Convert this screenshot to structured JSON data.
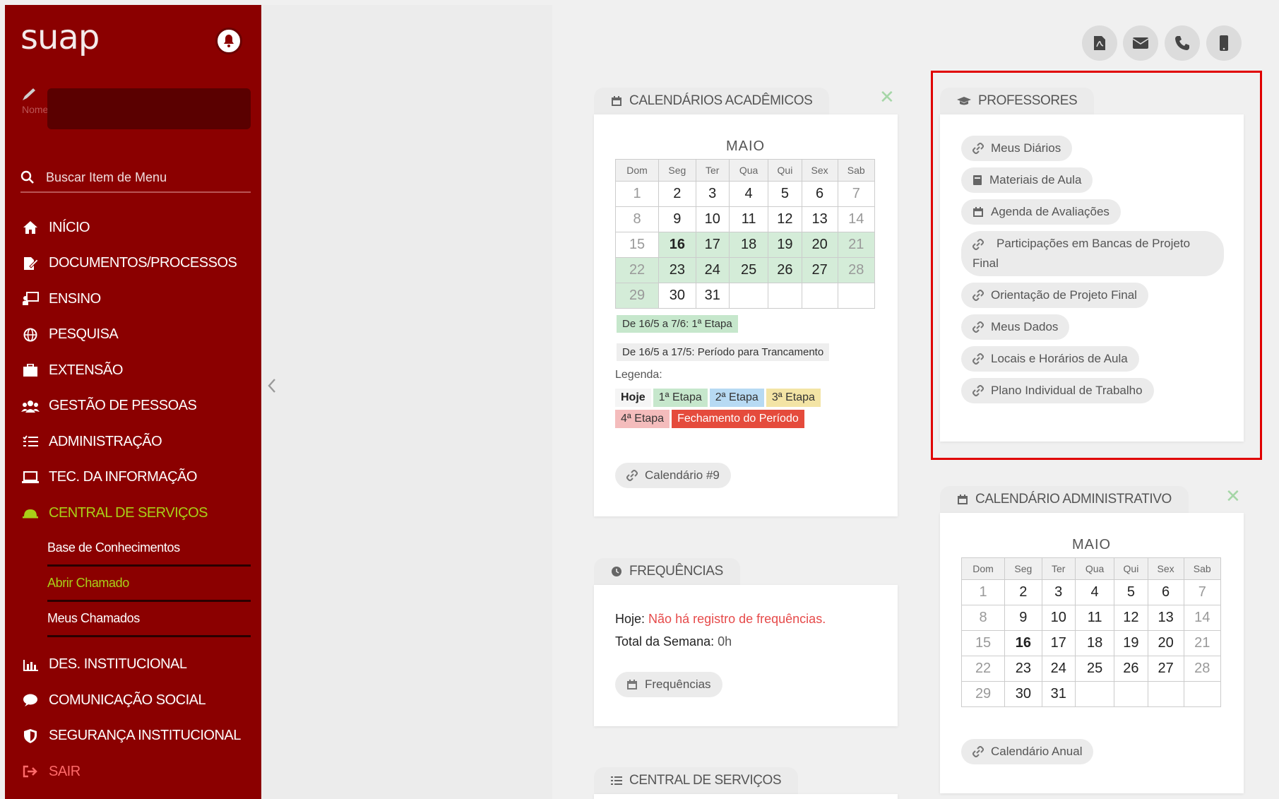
{
  "sidebar": {
    "logo": "suap",
    "user_name": "Nome",
    "search_placeholder": "Buscar Item de Menu",
    "items": [
      {
        "label": "INÍCIO"
      },
      {
        "label": "DOCUMENTOS/PROCESSOS"
      },
      {
        "label": "ENSINO"
      },
      {
        "label": "PESQUISA"
      },
      {
        "label": "EXTENSÃO"
      },
      {
        "label": "GESTÃO DE PESSOAS"
      },
      {
        "label": "ADMINISTRAÇÃO"
      },
      {
        "label": "TEC. DA INFORMAÇÃO"
      },
      {
        "label": "CENTRAL DE SERVIÇOS"
      },
      {
        "label": "DES. INSTITUCIONAL"
      },
      {
        "label": "COMUNICAÇÃO SOCIAL"
      },
      {
        "label": "SEGURANÇA INSTITUCIONAL"
      },
      {
        "label": "SAIR"
      }
    ],
    "submenu": [
      {
        "label": "Base de Conhecimentos"
      },
      {
        "label": "Abrir Chamado"
      },
      {
        "label": "Meus Chamados"
      }
    ]
  },
  "colors": {
    "sidebar": "#8b0000",
    "active": "#a9d018",
    "highlight_box": "#e00000"
  },
  "calendarios": {
    "title": "CALENDÁRIOS ACADÊMICOS",
    "month": "MAIO",
    "weekdays": [
      "Dom",
      "Seg",
      "Ter",
      "Qua",
      "Qui",
      "Sex",
      "Sab"
    ],
    "days": [
      "1",
      "2",
      "3",
      "4",
      "5",
      "6",
      "7",
      "8",
      "9",
      "10",
      "11",
      "12",
      "13",
      "14",
      "15",
      "16",
      "17",
      "18",
      "19",
      "20",
      "21",
      "22",
      "23",
      "24",
      "25",
      "26",
      "27",
      "28",
      "29",
      "30",
      "31"
    ],
    "period1": "De 16/5 a 7/6: 1ª Etapa",
    "period2": "De 16/5 a 17/5: Período para Trancamento",
    "legenda": "Legenda:",
    "leg": [
      "Hoje",
      "1ª Etapa",
      "2ª Etapa",
      "3ª Etapa",
      "4ª Etapa",
      "Fechamento do Período"
    ],
    "link": "Calendário #9"
  },
  "professores": {
    "title": "PROFESSORES",
    "links": [
      "Meus Diários",
      "Materiais de Aula",
      "Agenda de Avaliações",
      "Participações em Bancas de Projeto Final",
      "Orientação de Projeto Final",
      "Meus Dados",
      "Locais e Horários de Aula",
      "Plano Individual de Trabalho"
    ]
  },
  "frequencias": {
    "title": "FREQUÊNCIAS",
    "hoje_label": "Hoje:",
    "hoje_value": "Não há registro de frequências.",
    "total_label": "Total da Semana:",
    "total_value": "0h",
    "link": "Frequências"
  },
  "cal_admin": {
    "title": "CALENDÁRIO ADMINISTRATIVO",
    "month": "MAIO",
    "link": "Calendário Anual"
  },
  "central": {
    "title": "CENTRAL DE SERVIÇOS"
  },
  "top_icons": [
    "pdf-icon",
    "envelope-icon",
    "phone-icon",
    "mobile-icon"
  ]
}
